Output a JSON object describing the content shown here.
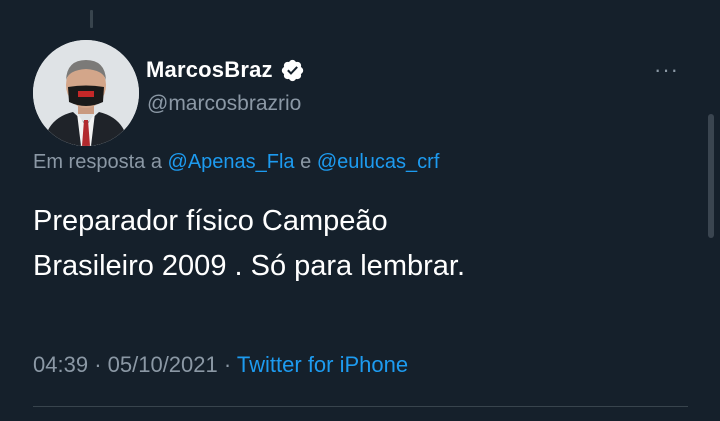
{
  "tweet": {
    "display_name": "MarcosBraz",
    "handle": "@marcosbrazrio",
    "verified_icon": "verified-badge-icon",
    "more_icon": "more-horizontal-icon",
    "more_label": "···",
    "reply": {
      "prefix": "Em resposta a",
      "user1": "@Apenas_Fla",
      "joiner": "e",
      "user2": "@eulucas_crf"
    },
    "text_line1": "Preparador físico Campeão",
    "text_line2": "Brasileiro 2009 . Só para lembrar.",
    "time": "04:39",
    "separator": "·",
    "date": "05/10/2021",
    "source": "Twitter for iPhone"
  },
  "colors": {
    "background": "#15202b",
    "primary_text": "#ffffff",
    "secondary_text": "#8b98a5",
    "link": "#1d9bf0"
  }
}
